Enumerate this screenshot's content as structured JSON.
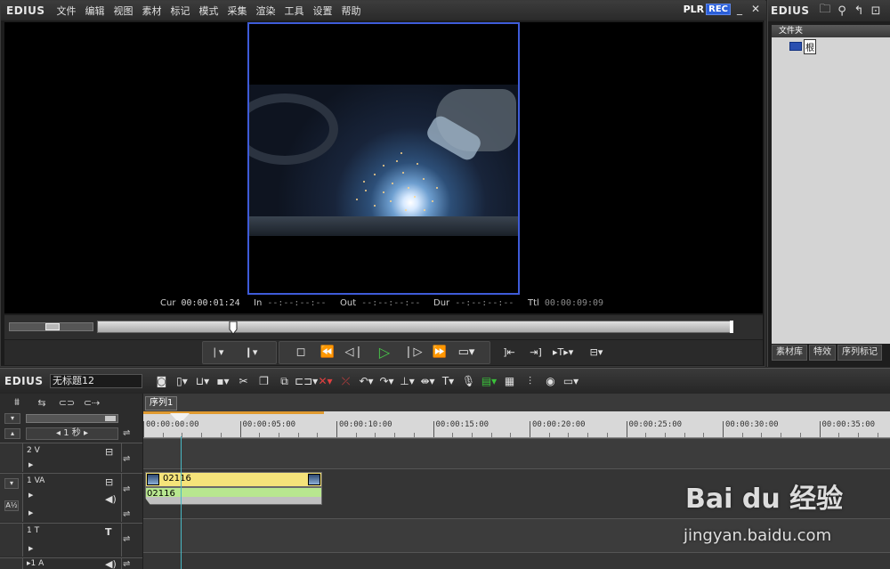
{
  "app": {
    "brand": "EDIUS"
  },
  "menu": [
    "文件",
    "编辑",
    "视图",
    "素材",
    "标记",
    "模式",
    "采集",
    "渲染",
    "工具",
    "设置",
    "帮助"
  ],
  "player": {
    "plr": "PLR",
    "rec": "REC",
    "minimize": "_",
    "close": "✕",
    "timecodes": {
      "cur_label": "Cur",
      "cur_value": "00:00:01:24",
      "in_label": "In",
      "in_value": "--:--:--:--",
      "out_label": "Out",
      "out_value": "--:--:--:--",
      "dur_label": "Dur",
      "dur_value": "--:--:--:--",
      "ttl_label": "Ttl",
      "ttl_value": "00:00:09:09"
    },
    "scrub_position": 0.214
  },
  "bin": {
    "brand": "EDIUS",
    "folder_header": "文件夹",
    "root_label": "根",
    "tabs": [
      "素材库",
      "特效",
      "序列标记"
    ]
  },
  "timeline": {
    "brand": "EDIUS",
    "project_name": "无标题12",
    "sequence_tab": "序列1",
    "scale": "1 秒",
    "ruler": [
      "00:00:00:00",
      "00:00:05:00",
      "00:00:10:00",
      "00:00:15:00",
      "00:00:20:00",
      "00:00:25:00",
      "00:00:30:00",
      "00:00:35:00"
    ],
    "tracks": [
      {
        "name": "2 V"
      },
      {
        "name": "1 VA"
      },
      {
        "name": "1 T"
      },
      {
        "name": "▸1 A"
      }
    ],
    "clip": {
      "video_name": "02116",
      "audio_name": "02116"
    }
  },
  "watermark": {
    "logo": "Bai du 经验",
    "url": "jingyan.baidu.com"
  },
  "colors": {
    "rec_badge": "#2b5fd9",
    "play": "#48c84a",
    "clip_video": "#f5e37a",
    "clip_audio": "#b8e78f",
    "frame_border": "#3e5bd8"
  }
}
